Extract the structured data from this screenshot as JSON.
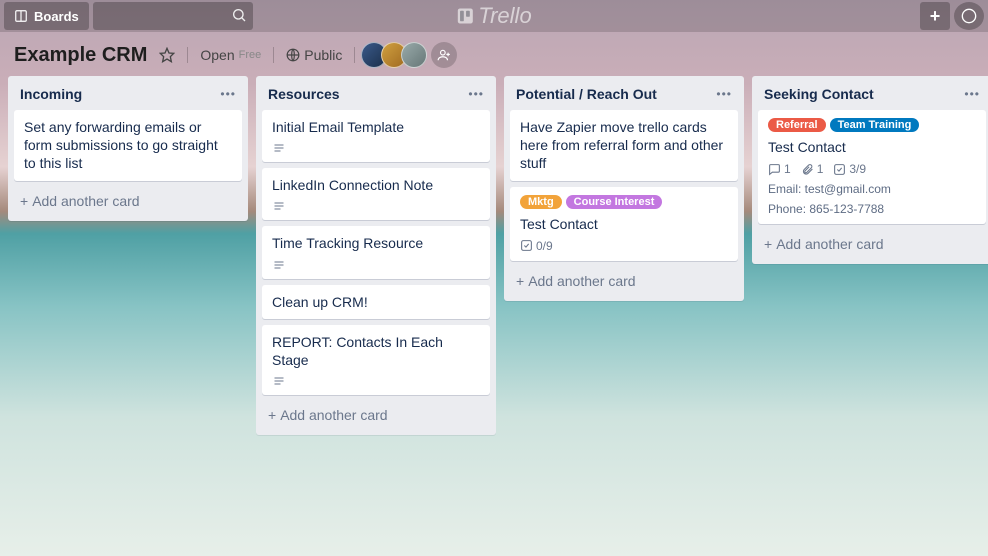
{
  "nav": {
    "boards_label": "Boards",
    "logo_text": "Trello",
    "plus": "+",
    "search_placeholder": ""
  },
  "board": {
    "title": "Example CRM",
    "open_label": "Open",
    "open_chip": "Free",
    "visibility_label": "Public",
    "add_member_glyph": "+"
  },
  "add_card_label": "Add another card",
  "labels": {
    "mktg": {
      "text": "Mktg",
      "color": "#f2a33a"
    },
    "course": {
      "text": "Course Interest",
      "color": "#c377e0"
    },
    "referral": {
      "text": "Referral",
      "color": "#eb5a46"
    },
    "team": {
      "text": "Team Training",
      "color": "#0079bf"
    }
  },
  "lists": [
    {
      "name": "Incoming",
      "cards": [
        {
          "title": "Set any forwarding emails or form submissions to go straight to this list"
        }
      ]
    },
    {
      "name": "Resources",
      "cards": [
        {
          "title": "Initial Email Template",
          "has_desc": true
        },
        {
          "title": "LinkedIn Connection Note",
          "has_desc": true
        },
        {
          "title": "Time Tracking Resource",
          "has_desc": true
        },
        {
          "title": "Clean up CRM!"
        },
        {
          "title": "REPORT: Contacts In Each Stage",
          "has_desc": true
        }
      ]
    },
    {
      "name": "Potential / Reach Out",
      "cards": [
        {
          "title": "Have Zapier move trello cards here from referral form and other stuff"
        },
        {
          "labels": [
            "mktg",
            "course"
          ],
          "title": "Test Contact",
          "checklist": "0/9"
        }
      ]
    },
    {
      "name": "Seeking Contact",
      "cards": [
        {
          "labels": [
            "referral",
            "team"
          ],
          "title": "Test Contact",
          "comments": "1",
          "attachments": "1",
          "checklist": "3/9",
          "extra": [
            "Email: test@gmail.com",
            "Phone: 865-123-7788"
          ]
        }
      ]
    }
  ]
}
